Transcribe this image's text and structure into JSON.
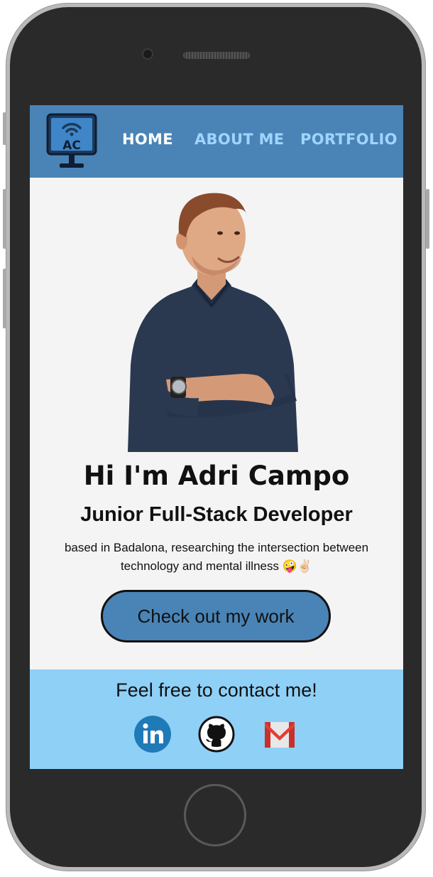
{
  "nav": {
    "logo_text": "AC",
    "items": [
      {
        "label": "HOME",
        "active": true
      },
      {
        "label": "ABOUT ME",
        "active": false
      },
      {
        "label": "PORTFOLIO",
        "active": false
      }
    ]
  },
  "hero": {
    "title": "Hi I'm Adri Campo",
    "subtitle": "Junior Full-Stack Developer",
    "description": "based in Badalona, researching the intersection between technology and mental illness 🤪✌🏻",
    "cta_label": "Check out my work"
  },
  "footer": {
    "title": "Feel free to contact me!",
    "icons": [
      "linkedin-icon",
      "github-icon",
      "gmail-icon"
    ]
  },
  "colors": {
    "nav_bg": "#4a84b6",
    "nav_active": "#ffffff",
    "nav_inactive": "#9fd4ff",
    "footer_bg": "#8fd0f7",
    "page_bg": "#f4f4f4"
  }
}
